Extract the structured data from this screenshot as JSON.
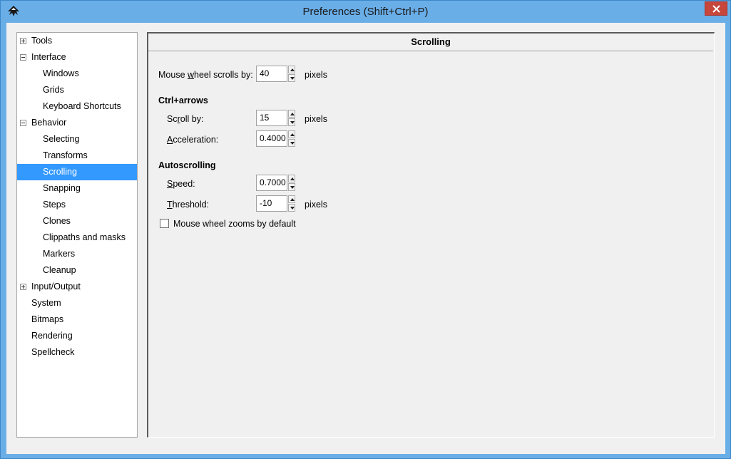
{
  "window": {
    "title": "Preferences (Shift+Ctrl+P)",
    "icon": "inkscape-logo-icon",
    "close_icon": "close-icon",
    "colors": {
      "titlebar": "#6aaee8",
      "close": "#c7463c",
      "selection": "#3399ff"
    }
  },
  "tree": {
    "items": [
      {
        "label": "Tools",
        "expander": "plus"
      },
      {
        "label": "Interface",
        "expander": "minus"
      },
      {
        "label": "Windows"
      },
      {
        "label": "Grids"
      },
      {
        "label": "Keyboard Shortcuts"
      },
      {
        "label": "Behavior",
        "expander": "minus"
      },
      {
        "label": "Selecting"
      },
      {
        "label": "Transforms"
      },
      {
        "label": "Scrolling",
        "selected": true
      },
      {
        "label": "Snapping"
      },
      {
        "label": "Steps"
      },
      {
        "label": "Clones"
      },
      {
        "label": "Clippaths and masks"
      },
      {
        "label": "Markers"
      },
      {
        "label": "Cleanup"
      },
      {
        "label": "Input/Output",
        "expander": "plus"
      },
      {
        "label": "System"
      },
      {
        "label": "Bitmaps"
      },
      {
        "label": "Rendering"
      },
      {
        "label": "Spellcheck"
      }
    ]
  },
  "panel": {
    "title": "Scrolling",
    "mouse_wheel": {
      "label_pre": "Mouse ",
      "label_u": "w",
      "label_post": "heel scrolls by:",
      "value": "40",
      "unit": "pixels"
    },
    "ctrl_arrows": {
      "heading": "Ctrl+arrows",
      "scroll_by": {
        "label_pre": "Sc",
        "label_u": "r",
        "label_post": "oll by:",
        "value": "15",
        "unit": "pixels"
      },
      "acceleration": {
        "label_pre": "",
        "label_u": "A",
        "label_post": "cceleration:",
        "value": "0.4000"
      }
    },
    "autoscrolling": {
      "heading": "Autoscrolling",
      "speed": {
        "label_pre": "",
        "label_u": "S",
        "label_post": "peed:",
        "value": "0.7000"
      },
      "threshold": {
        "label_pre": "",
        "label_u": "T",
        "label_post": "hreshold:",
        "value": "-10",
        "unit": "pixels"
      }
    },
    "zoom_checkbox": {
      "label": "Mouse wheel zooms by default",
      "checked": false
    }
  }
}
